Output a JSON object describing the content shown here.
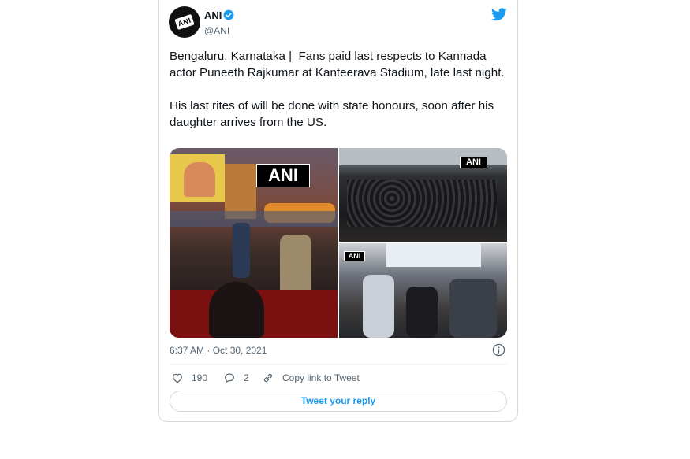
{
  "author": {
    "name": "ANI",
    "handle": "@ANI",
    "avatar_text": "ANI",
    "verified": true
  },
  "tweet": {
    "paragraph_1": "Bengaluru, Karnataka |  Fans paid last respects to Kannada actor Puneeth Rajkumar at Kanteerava Stadium, late last night.",
    "paragraph_2": "His last rites of will be done with state honours, soon after his daughter arrives from the US."
  },
  "media": {
    "watermarks": [
      "ANI",
      "ANI",
      "ANI"
    ]
  },
  "timestamp": "6:37 AM · Oct 30, 2021",
  "actions": {
    "likes": "190",
    "replies": "2",
    "copy_link": "Copy link to Tweet"
  },
  "reply_button": "Tweet your reply",
  "colors": {
    "accent": "#1d9bf0",
    "text": "#0f1419",
    "muted": "#536471",
    "border": "#cfd9de"
  },
  "icons": [
    "verified-icon",
    "twitter-bird-icon",
    "info-icon",
    "heart-icon",
    "reply-bubble-icon",
    "link-icon"
  ]
}
